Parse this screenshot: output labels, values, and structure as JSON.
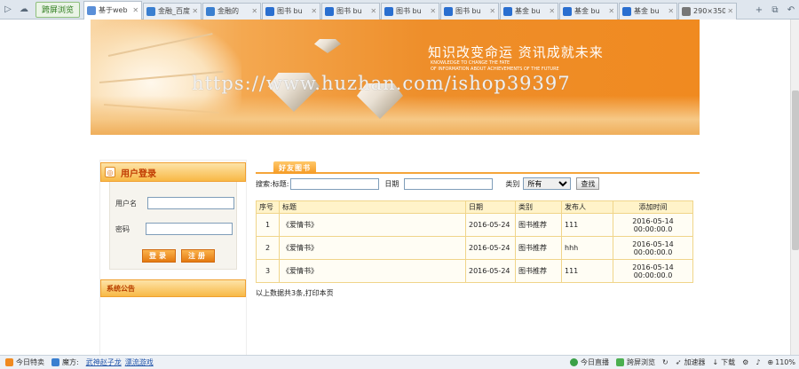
{
  "browser": {
    "special_tab": "跨屏浏览",
    "tabs": [
      {
        "label": "基于web",
        "active": true
      },
      {
        "label": "金融_百度",
        "active": false
      },
      {
        "label": "金融的",
        "active": false
      },
      {
        "label": "图书 bu",
        "active": false
      },
      {
        "label": "图书 bu",
        "active": false
      },
      {
        "label": "图书 bu",
        "active": false
      },
      {
        "label": "图书 bu",
        "active": false
      },
      {
        "label": "基金 bu",
        "active": false
      },
      {
        "label": "基金 bu",
        "active": false
      },
      {
        "label": "基金 bu",
        "active": false
      },
      {
        "label": "290×350",
        "active": false
      }
    ]
  },
  "banner": {
    "slogan": "知识改变命运 资讯成就未来",
    "slogan_en_1": "KNOWLEDGE TO CHANGE THE FATE",
    "slogan_en_2": "OF INFORMATION ABOUT ACHIEVEMENTS OF THE FUTURE",
    "watermark": "https://www.huzhan.com/ishop39397"
  },
  "login": {
    "title": "用户登录",
    "username_label": "用户名",
    "password_label": "密码",
    "login_button": "登录",
    "register_button": "注册"
  },
  "notice": {
    "title": "系统公告"
  },
  "main": {
    "tab_label": "好友图书",
    "search": {
      "prefix": "搜索:标题:",
      "date_label": "日期",
      "category_label": "类别",
      "category_selected": "所有",
      "search_button": "查找"
    },
    "table": {
      "headers": [
        "序号",
        "标题",
        "日期",
        "类别",
        "发布人",
        "添加时间"
      ],
      "rows": [
        {
          "no": "1",
          "title": "《爱情书》",
          "date": "2016-05-24",
          "category": "图书推荐",
          "publisher": "111",
          "added_1": "2016-05-14",
          "added_2": "00:00:00.0"
        },
        {
          "no": "2",
          "title": "《爱情书》",
          "date": "2016-05-24",
          "category": "图书推荐",
          "publisher": "hhh",
          "added_1": "2016-05-14",
          "added_2": "00:00:00.0"
        },
        {
          "no": "3",
          "title": "《爱情书》",
          "date": "2016-05-24",
          "category": "图书推荐",
          "publisher": "111",
          "added_1": "2016-05-14",
          "added_2": "00:00:00.0"
        }
      ]
    },
    "footer_note": "以上数据共3条,打印本页"
  },
  "statusbar": {
    "today_special": "今日特卖",
    "magic_label": "魔方:",
    "link1": "武神赵子龙",
    "link2": "漂流游戏",
    "live": "今日直播",
    "cross_screen": "跨屏浏览",
    "accelerator": "加速器",
    "download": "下载",
    "zoom": "110%"
  }
}
